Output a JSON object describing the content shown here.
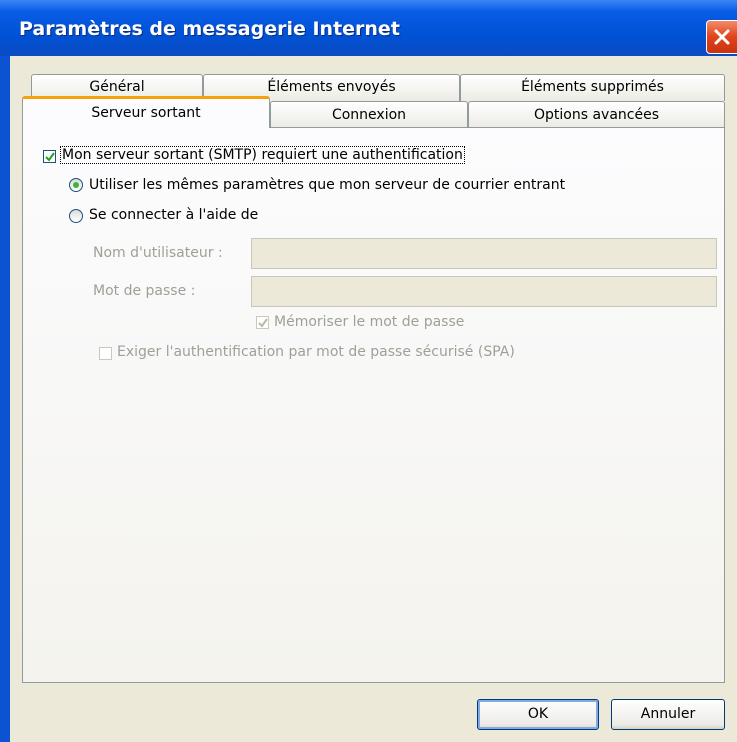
{
  "window": {
    "title": "Paramètres de messagerie Internet"
  },
  "tabs": {
    "row_back": [
      {
        "label": "Général"
      },
      {
        "label": "Éléments envoyés"
      },
      {
        "label": "Éléments supprimés"
      }
    ],
    "row_front": [
      {
        "label": "Serveur sortant",
        "active": true
      },
      {
        "label": "Connexion"
      },
      {
        "label": "Options avancées"
      }
    ]
  },
  "panel": {
    "auth_checkbox_label": "Mon serveur sortant (SMTP) requiert une authentification",
    "auth_checked": true,
    "radio_same": "Utiliser les mêmes paramètres que mon serveur de courrier entrant",
    "radio_same_selected": true,
    "radio_login": "Se connecter à l'aide de",
    "username_label": "Nom d'utilisateur :",
    "username_value": "",
    "password_label": "Mot de passe :",
    "password_value": "",
    "remember_label": "Mémoriser le mot de passe",
    "remember_checked": true,
    "spa_label": "Exiger l'authentification par mot de passe sécurisé (SPA)",
    "spa_checked": false
  },
  "buttons": {
    "ok": "OK",
    "cancel": "Annuler"
  }
}
